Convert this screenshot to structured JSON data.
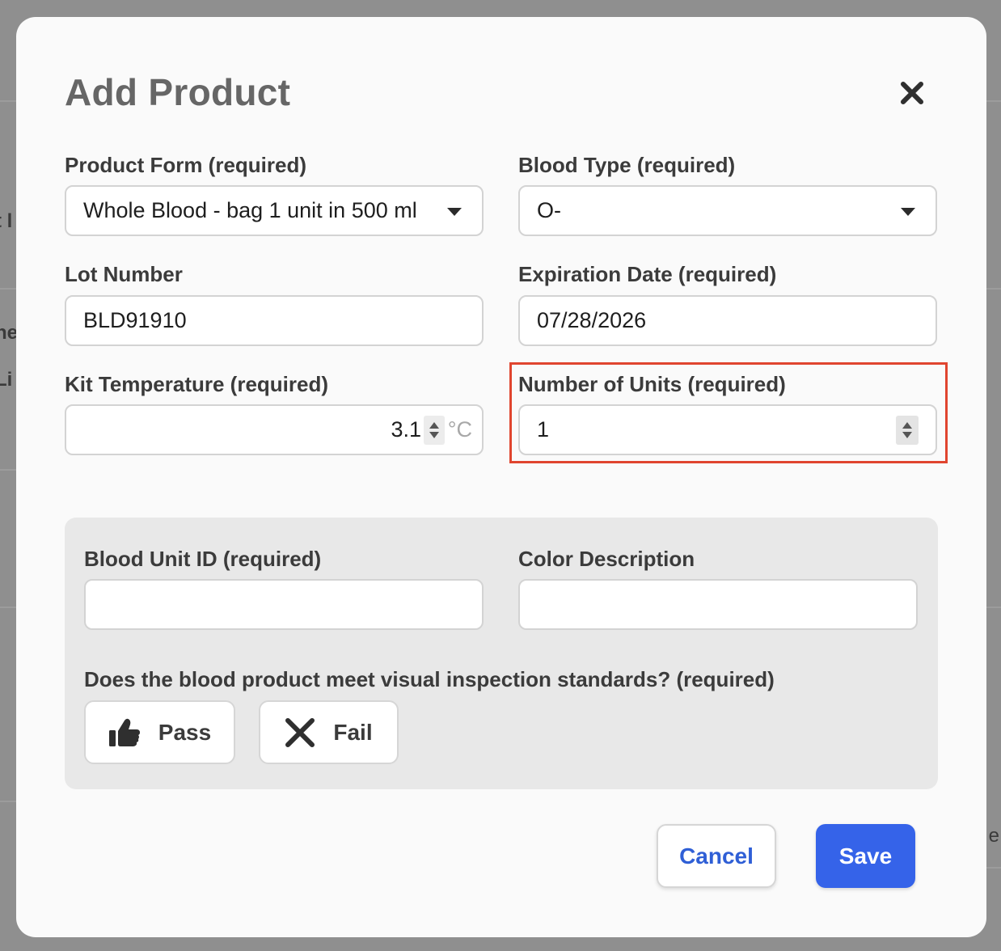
{
  "background": {
    "left_fragments": [
      "t l",
      "ne",
      "Li"
    ],
    "right_fragment": "e"
  },
  "modal": {
    "title": "Add Product",
    "close_icon": "close-x-icon"
  },
  "fields": {
    "product_form": {
      "label": "Product Form (required)",
      "value": "Whole Blood - bag 1 unit in 500 ml"
    },
    "blood_type": {
      "label": "Blood Type (required)",
      "value": "O-"
    },
    "lot_number": {
      "label": "Lot Number",
      "value": "BLD91910"
    },
    "expiration_date": {
      "label": "Expiration Date (required)",
      "value": "07/28/2026"
    },
    "kit_temperature": {
      "label": "Kit Temperature (required)",
      "value": "3.1",
      "unit": "°C"
    },
    "number_of_units": {
      "label": "Number of Units (required)",
      "value": "1"
    }
  },
  "inspection": {
    "blood_unit_id_label": "Blood Unit ID (required)",
    "blood_unit_id_value": "",
    "color_description_label": "Color Description",
    "color_description_value": "",
    "question": "Does the blood product meet visual inspection standards? (required)",
    "pass_label": "Pass",
    "pass_icon": "thumbs-up-icon",
    "fail_label": "Fail",
    "fail_icon": "x-icon"
  },
  "footer": {
    "cancel_label": "Cancel",
    "save_label": "Save"
  },
  "colors": {
    "accent": "#3563e9",
    "highlight": "#e0452f"
  }
}
